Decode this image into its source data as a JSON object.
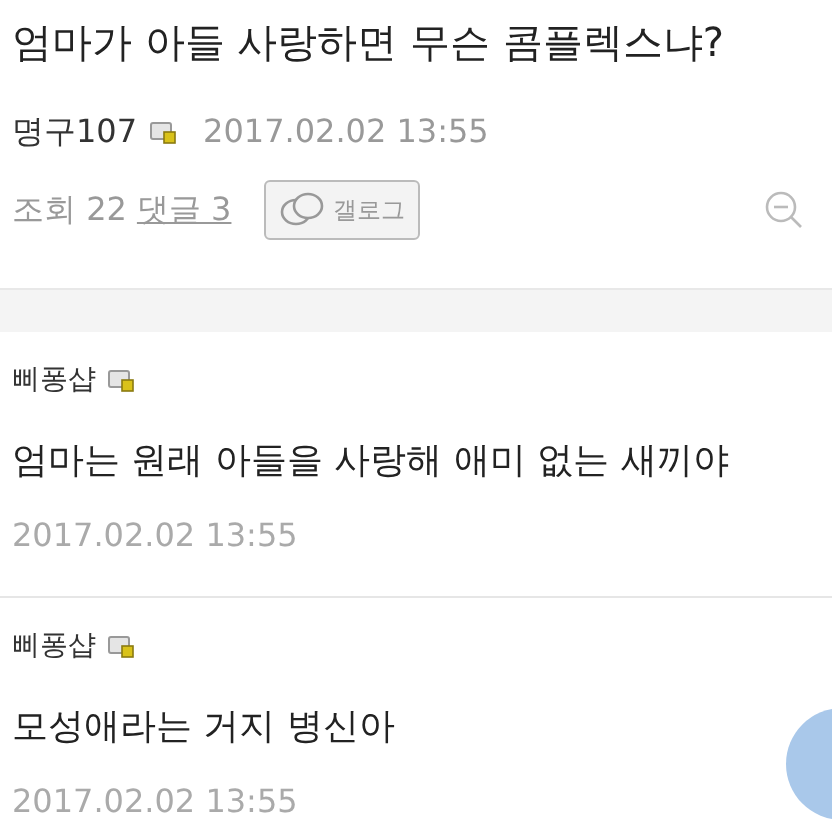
{
  "post": {
    "title": "엄마가 아들 사랑하면 무슨 콤플렉스냐?",
    "author": "명구107",
    "date": "2017.02.02 13:55",
    "views_label": "조회 22",
    "comments_link": "댓글 3",
    "gallog_button": "갤로그"
  },
  "comments": [
    {
      "author": "삐퐁샵",
      "body": "엄마는 원래 아들을 사랑해 애미 없는 새끼야",
      "date": "2017.02.02 13:55"
    },
    {
      "author": "삐퐁샵",
      "body": "모성애라는 거지 병신아",
      "date": "2017.02.02 13:55"
    }
  ]
}
